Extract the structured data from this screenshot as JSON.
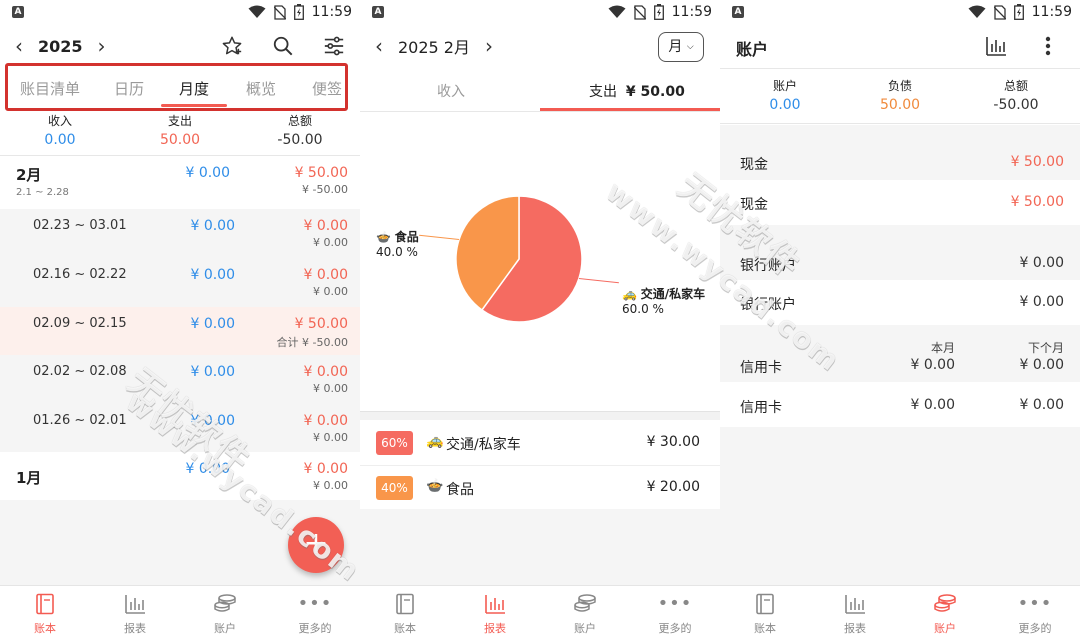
{
  "status": {
    "time": "11:59"
  },
  "p1": {
    "year": "2025",
    "tabs": [
      "账目清单",
      "日历",
      "月度",
      "概览",
      "便签"
    ],
    "summary": {
      "income_label": "收入",
      "income": "0.00",
      "expense_label": "支出",
      "expense": "50.00",
      "total_label": "总额",
      "total": "-50.00"
    },
    "feb": {
      "title": "2月",
      "range": "2.1 ~ 2.28",
      "income": "¥ 0.00",
      "expense": "¥ 50.00",
      "net": "¥ -50.00"
    },
    "weeks": [
      {
        "range": "02.23  ~  03.01",
        "income": "¥ 0.00",
        "expense": "¥ 0.00",
        "net": "¥ 0.00"
      },
      {
        "range": "02.16  ~  02.22",
        "income": "¥ 0.00",
        "expense": "¥ 0.00",
        "net": "¥ 0.00"
      },
      {
        "range": "02.09  ~  02.15",
        "income": "¥ 0.00",
        "expense": "¥ 50.00",
        "net": "合计 ¥ -50.00"
      },
      {
        "range": "02.02  ~  02.08",
        "income": "¥ 0.00",
        "expense": "¥ 0.00",
        "net": "¥ 0.00"
      },
      {
        "range": "01.26  ~  02.01",
        "income": "¥ 0.00",
        "expense": "¥ 0.00",
        "net": "¥ 0.00"
      }
    ],
    "jan": {
      "title": "1月",
      "income": "¥ 0.00",
      "expense": "¥ 0.00",
      "net": "¥ 0.00"
    }
  },
  "p2": {
    "title": "2025 2月",
    "period": "月",
    "tab_income": "收入",
    "tab_expense": "支出",
    "expense_total": "¥ 50.00",
    "slices": [
      {
        "name": "交通/私家车",
        "percent": 60.0,
        "percent_label": "60.0 %",
        "badge": "60%",
        "amount": "¥ 30.00",
        "color": "#f56b61"
      },
      {
        "name": "食品",
        "percent": 40.0,
        "percent_label": "40.0 %",
        "badge": "40%",
        "amount": "¥ 20.00",
        "color": "#f9964a"
      }
    ]
  },
  "p3": {
    "title": "账户",
    "summary": {
      "acct_label": "账户",
      "acct": "0.00",
      "debt_label": "负债",
      "debt": "50.00",
      "total_label": "总额",
      "total": "-50.00"
    },
    "cash_group": {
      "label": "现金",
      "value": "¥ 50.00"
    },
    "cash_item": {
      "label": "现金",
      "value": "¥ 50.00"
    },
    "bank_group": {
      "label": "银行账户",
      "value": "¥ 0.00"
    },
    "bank_item": {
      "label": "银行账户",
      "value": "¥ 0.00"
    },
    "credit_group": {
      "label": "信用卡",
      "this_month_label": "本月",
      "next_month_label": "下个月",
      "this_month": "¥ 0.00",
      "next_month": "¥ 0.00"
    },
    "credit_item": {
      "label": "信用卡",
      "this_month": "¥ 0.00",
      "next_month": "¥ 0.00"
    }
  },
  "nav": [
    "账本",
    "报表",
    "账户",
    "更多的"
  ],
  "watermark": {
    "cn": "无忧软件",
    "url": "www.wycad.com"
  }
}
